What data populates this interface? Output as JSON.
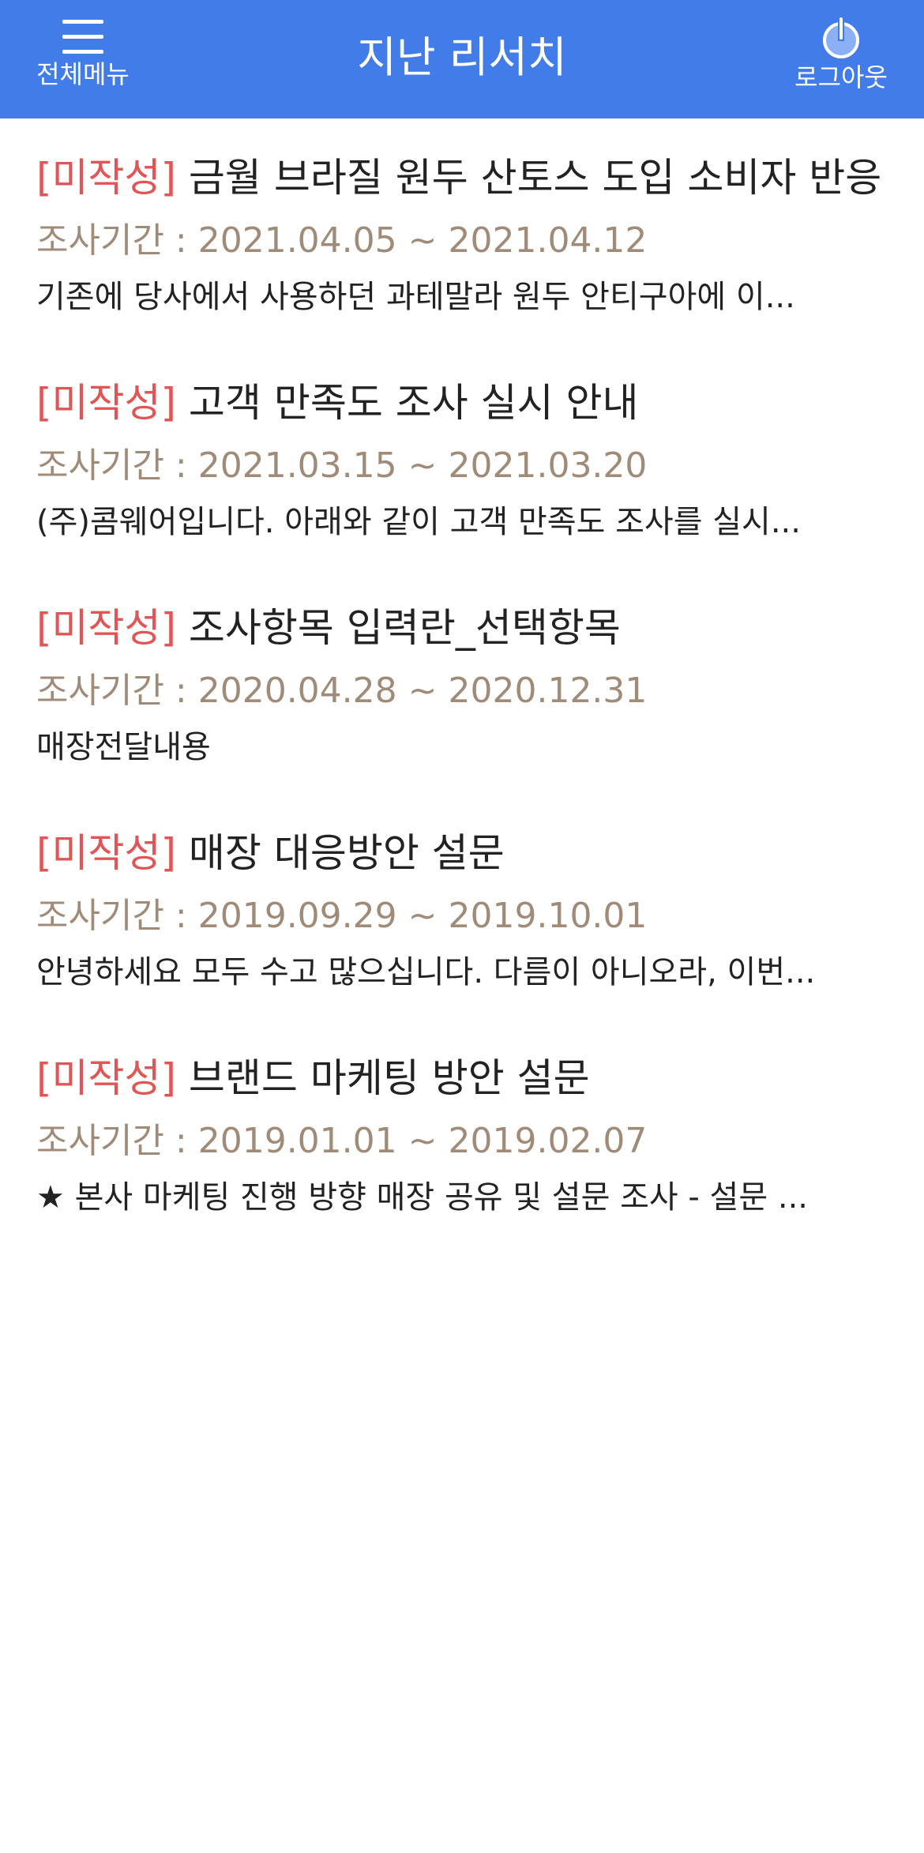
{
  "header": {
    "title": "지난 리서치",
    "menu_label": "전체메뉴",
    "logout_label": "로그아웃",
    "background_color": "#427ce8",
    "menu_icon": "hamburger-icon",
    "logout_icon": "power-icon"
  },
  "colors": {
    "status": "#e05656",
    "period": "#a08b78",
    "text": "#222222"
  },
  "items": [
    {
      "status": "[미작성]",
      "title": "금월 브라질 원두 산토스 도입 소비자 반응",
      "period": "조사기간 : 2021.04.05 ~ 2021.04.12",
      "summary": "기존에 당사에서 사용하던 과테말라 원두 안티구아에 이..."
    },
    {
      "status": "[미작성]",
      "title": "고객 만족도 조사 실시 안내",
      "period": "조사기간 : 2021.03.15 ~ 2021.03.20",
      "summary": "(주)콤웨어입니다. 아래와 같이 고객 만족도 조사를 실시..."
    },
    {
      "status": "[미작성]",
      "title": "조사항목 입력란_선택항목",
      "period": "조사기간 : 2020.04.28 ~ 2020.12.31",
      "summary": "매장전달내용"
    },
    {
      "status": "[미작성]",
      "title": "매장 대응방안 설문",
      "period": "조사기간 : 2019.09.29 ~ 2019.10.01",
      "summary": "안녕하세요 모두 수고 많으십니다. 다름이 아니오라, 이번..."
    },
    {
      "status": "[미작성]",
      "title": "브랜드 마케팅 방안 설문",
      "period": "조사기간 : 2019.01.01 ~ 2019.02.07",
      "summary": "★ 본사 마케팅 진행 방향 매장 공유 및 설문 조사 - 설문 ..."
    }
  ]
}
